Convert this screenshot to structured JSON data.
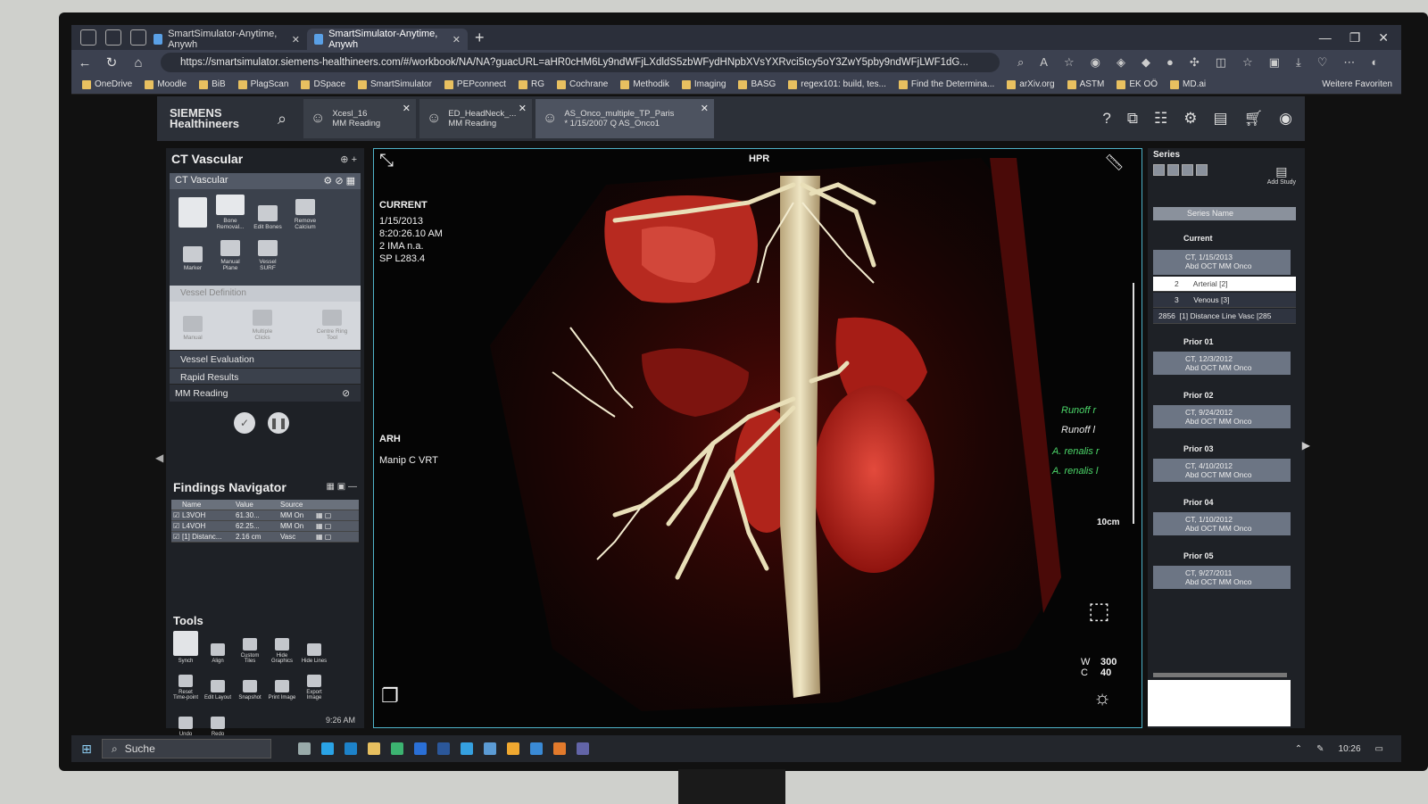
{
  "browser": {
    "tabs": [
      {
        "label": "SmartSimulator-Anytime, Anywh",
        "active": false
      },
      {
        "label": "SmartSimulator-Anytime, Anywh",
        "active": true
      }
    ],
    "url": "https://smartsimulator.siemens-healthineers.com/#/workbook/NA/NA?guacURL=aHR0cHM6Ly9ndWFjLXdldS5zbWFydHNpbXVsYXRvci5tcy5oY3ZwY5pby9ndWFjLWF1dG...",
    "bookmarks": [
      "OneDrive",
      "Moodle",
      "BiB",
      "PlagScan",
      "DSpace",
      "SmartSimulator",
      "PEPconnect",
      "RG",
      "Cochrane",
      "Methodik",
      "Imaging",
      "BASG",
      "regex101: build, tes...",
      "Find the Determina...",
      "arXiv.org",
      "ASTM",
      "EK OÖ",
      "MD.ai"
    ],
    "bookmarks_more": "Weitere Favoriten"
  },
  "app": {
    "logo_line1": "SIEMENS",
    "logo_line2": "Healthineers",
    "tabs": [
      {
        "line1": "Xcesl_16",
        "line2": "MM Reading"
      },
      {
        "line1": "ED_HeadNeck_...",
        "line2": "MM Reading"
      },
      {
        "line1": "AS_Onco_multiple_TP_Paris",
        "line2": "* 1/15/2007 Q AS_Onco1"
      }
    ]
  },
  "workflow": {
    "title": "CT Vascular",
    "panel_header": "CT Vascular",
    "tools": [
      {
        "label": ""
      },
      {
        "label": "Bone Removal..."
      },
      {
        "label": "Edit Bones"
      },
      {
        "label": "Remove Calcium"
      },
      {
        "label": "Marker"
      },
      {
        "label": "Manual Plane"
      },
      {
        "label": "Vessel SURF"
      }
    ],
    "vessel_definition": "Vessel Definition",
    "vessel_def_tools": [
      "Manual",
      "Multiple Clicks",
      "Centre Ring Tool"
    ],
    "rows": [
      "Vessel Evaluation",
      "Rapid Results",
      "MM Reading"
    ]
  },
  "findings": {
    "title": "Findings Navigator",
    "columns": [
      "",
      "Name",
      "Value",
      "Source"
    ],
    "rows": [
      {
        "name": "L3VOH",
        "value": "61.30...",
        "source": "MM On"
      },
      {
        "name": "L4VOH",
        "value": "62.25...",
        "source": "MM On"
      },
      {
        "name": "[1] Distanc...",
        "value": "2.16 cm",
        "source": "Vasc"
      }
    ]
  },
  "tools": {
    "title": "Tools",
    "items": [
      "Synch",
      "Align",
      "Custom Tiles",
      "Hide Graphics",
      "Hide Lines",
      "Reset Time-point",
      "Edit Layout",
      "Snapshot",
      "Print Image",
      "Export Image",
      "Undo",
      "Redo"
    ],
    "time": "9:26 AM"
  },
  "viewer": {
    "label_top": "HPR",
    "state": "CURRENT",
    "date": "1/15/2013",
    "time": "8:20:26.10 AM",
    "ima": "2 IMA n.a.",
    "sp": "SP L283.4",
    "orient": "ARH",
    "mode": "Manip C VRT",
    "anatomy": [
      "Runoff r",
      "Runoff l",
      "A. renalis r",
      "A. renalis l"
    ],
    "scale": "10cm",
    "w_label": "W",
    "c_label": "C",
    "w_value": "300",
    "c_value": "40"
  },
  "series": {
    "title": "Series",
    "add_study": "Add Study",
    "column": "Series Name",
    "current_label": "Current",
    "current_study": {
      "line1": "CT, 1/15/2013",
      "line2": "Abd OCT MM Onco"
    },
    "current_rows": [
      {
        "num": "2",
        "name": "Arterial [2]"
      },
      {
        "num": "3",
        "name": "Venous [3]"
      },
      {
        "num": "2856",
        "name": "[1] Distance Line Vasc [285"
      }
    ],
    "priors": [
      {
        "label": "Prior 01",
        "line1": "CT, 12/3/2012",
        "line2": "Abd OCT MM Onco"
      },
      {
        "label": "Prior 02",
        "line1": "CT, 9/24/2012",
        "line2": "Abd OCT MM Onco"
      },
      {
        "label": "Prior 03",
        "line1": "CT, 4/10/2012",
        "line2": "Abd OCT MM Onco"
      },
      {
        "label": "Prior 04",
        "line1": "CT, 1/10/2012",
        "line2": "Abd OCT MM Onco"
      },
      {
        "label": "Prior 05",
        "line1": "CT, 9/27/2011",
        "line2": "Abd OCT MM Onco"
      }
    ]
  },
  "taskbar": {
    "search": "Suche",
    "time": "10:26"
  },
  "colors": {
    "viewer_border": "#4fb3c9",
    "anatomy_green": "#4cd86a",
    "vessel_bone": "#e8dcb0",
    "perfusion_red": "#c8231c"
  }
}
